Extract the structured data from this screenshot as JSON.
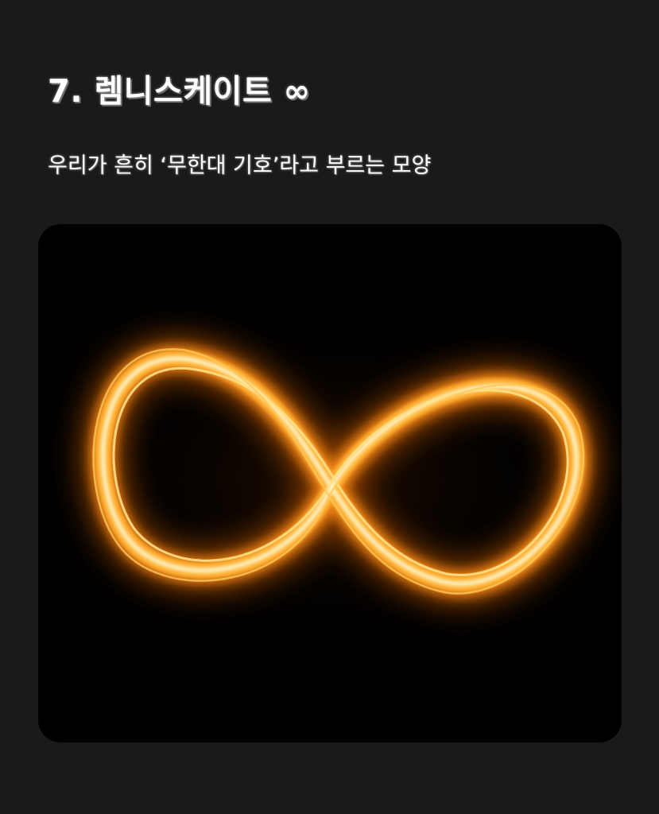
{
  "heading": {
    "title": "7. 렘니스케이트 ∞",
    "subtitle": "우리가 흔히 ‘무한대 기호’라고 부르는 모양"
  },
  "image": {
    "subject": "fiery-infinity-symbol-icon",
    "colors": {
      "background": "#1a1a1a",
      "card": "#000000",
      "flame_core": "#fff3c4",
      "flame_mid": "#ffb030",
      "flame_outer": "#e86a00"
    }
  }
}
